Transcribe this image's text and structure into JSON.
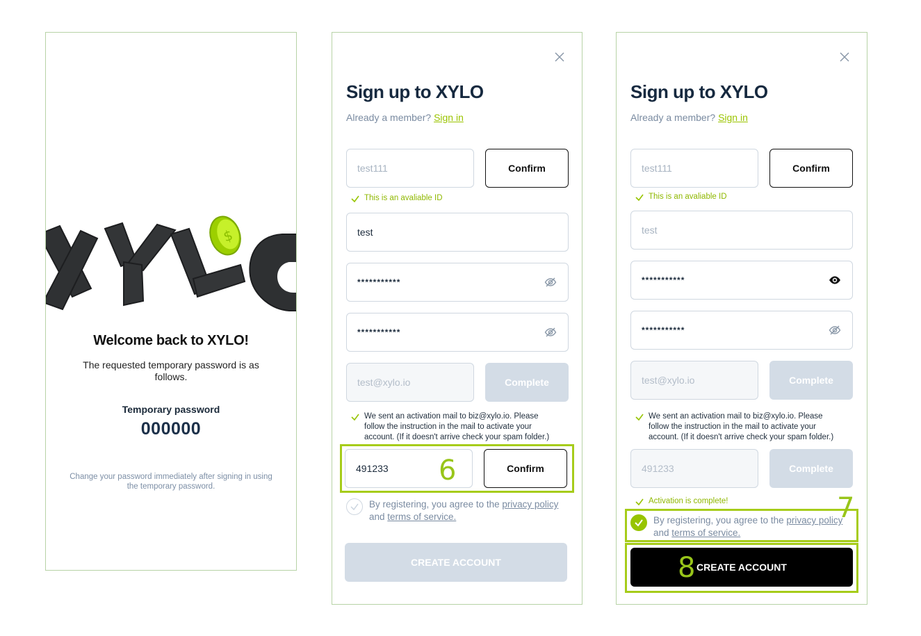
{
  "welcome_panel": {
    "logo_text": "XYLO",
    "title": "Welcome back to XYLO!",
    "message": "The requested temporary password is as follows.",
    "temp_password_label": "Temporary password",
    "temp_password_value": "000000",
    "note": "Change your password immediately after signing in using the temporary password."
  },
  "signup_step6": {
    "title": "Sign up to XYLO",
    "member_prompt": "Already a member?",
    "sign_in_link": "Sign in",
    "id_value": "test111",
    "id_confirm_button": "Confirm",
    "id_available_msg": "This is an avaliable ID",
    "name_value": "test",
    "password_value": "***********",
    "password_confirm_value": "***********",
    "email_placeholder": "test@xylo.io",
    "email_complete_button": "Complete",
    "activation_sent_msg": "We sent an activation mail to biz@xylo.io. Please follow the instruction in the mail to activate your account. (If it doesn't arrive check your spam folder.)",
    "code_value": "491233",
    "code_confirm_button": "Confirm",
    "step_number": "6",
    "agree_prefix": "By registering, you agree to the ",
    "privacy_link": "privacy policy",
    "agree_and": "and ",
    "terms_link": "terms of service.",
    "agreed": false,
    "create_button": "CREATE ACCOUNT"
  },
  "signup_step78": {
    "title": "Sign up to XYLO",
    "member_prompt": "Already a member?",
    "sign_in_link": "Sign in",
    "id_value": "test111",
    "id_confirm_button": "Confirm",
    "id_available_msg": "This is an avaliable ID",
    "name_value": "test",
    "password_value": "***********",
    "password_confirm_value": "***********",
    "email_placeholder": "test@xylo.io",
    "email_complete_button": "Complete",
    "activation_sent_msg": "We sent an activation mail to biz@xylo.io. Please follow the instruction in the mail to activate your account. (If it doesn't arrive check your spam folder.)",
    "code_value": "491233",
    "code_complete_button": "Complete",
    "activation_complete_msg": "Activation is complete!",
    "step_number_7": "7",
    "step_number_8": "8",
    "agree_prefix": "By registering, you agree to the ",
    "privacy_link": "privacy policy",
    "agree_and": "and ",
    "terms_link": "terms of service.",
    "agreed": true,
    "create_button": "CREATE ACCOUNT"
  },
  "colors": {
    "accent": "#97c400",
    "highlight": "#a6cc1a",
    "panel_border": "#b7d3a6",
    "title": "#16293f",
    "disabled_button": "#d3dce6"
  }
}
